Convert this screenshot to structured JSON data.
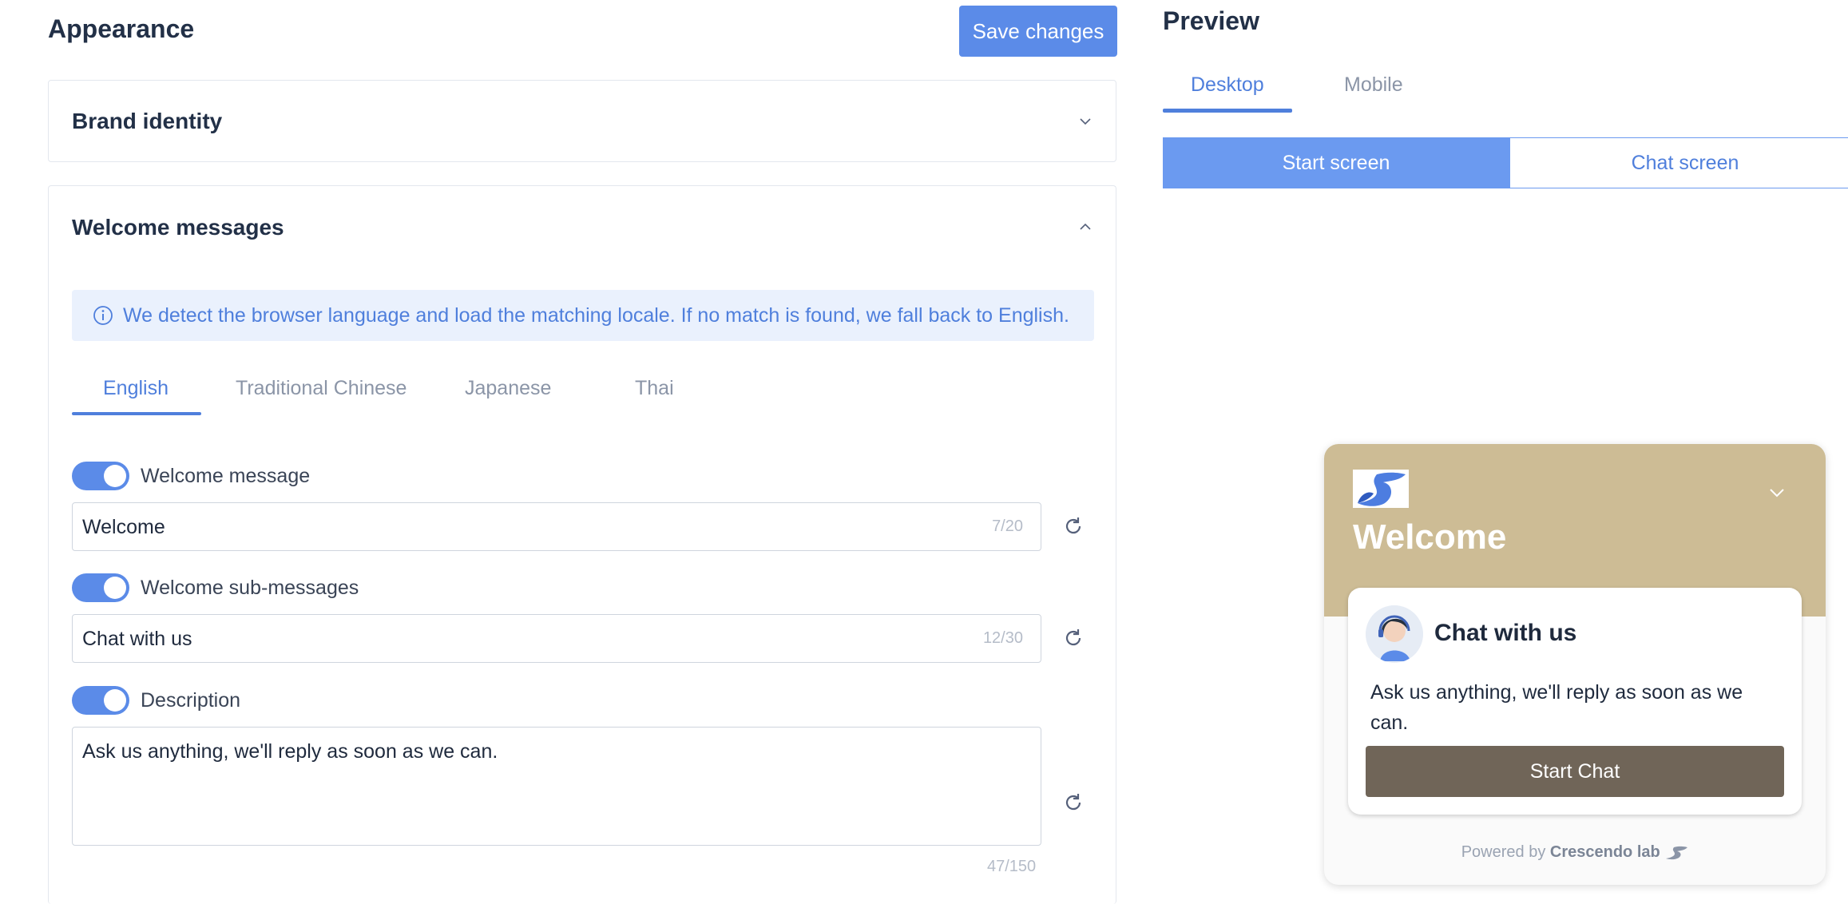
{
  "page": {
    "title": "Appearance",
    "save_label": "Save changes"
  },
  "brand_identity": {
    "title": "Brand identity"
  },
  "welcome_messages": {
    "title": "Welcome messages",
    "info": "We detect the browser language and load the matching locale. If no match is found, we fall back to English.",
    "tabs": [
      {
        "label": "English",
        "active": true
      },
      {
        "label": "Traditional Chinese",
        "active": false
      },
      {
        "label": "Japanese",
        "active": false
      },
      {
        "label": "Thai",
        "active": false
      }
    ],
    "fields": {
      "welcome_message": {
        "label": "Welcome message",
        "value": "Welcome",
        "counter": "7/20",
        "enabled": true
      },
      "sub_messages": {
        "label": "Welcome sub-messages",
        "value": "Chat with us",
        "counter": "12/30",
        "enabled": true
      },
      "description": {
        "label": "Description",
        "value": "Ask us anything, we'll reply as soon as we can.",
        "counter": "47/150",
        "enabled": true
      }
    }
  },
  "preview": {
    "title": "Preview",
    "device_tabs": [
      {
        "label": "Desktop",
        "active": true
      },
      {
        "label": "Mobile",
        "active": false
      }
    ],
    "screen_tabs": [
      {
        "label": "Start screen",
        "active": true
      },
      {
        "label": "Chat screen",
        "active": false
      }
    ],
    "widget": {
      "title": "Welcome",
      "card_title": "Chat with us",
      "card_desc": "Ask us anything, we'll reply as soon as we can.",
      "start_label": "Start Chat",
      "powered_by": "Powered by",
      "brand": "Crescendo lab",
      "header_color": "#cdbc95",
      "button_color": "#706558"
    }
  },
  "colors": {
    "accent": "#5b8be8"
  }
}
